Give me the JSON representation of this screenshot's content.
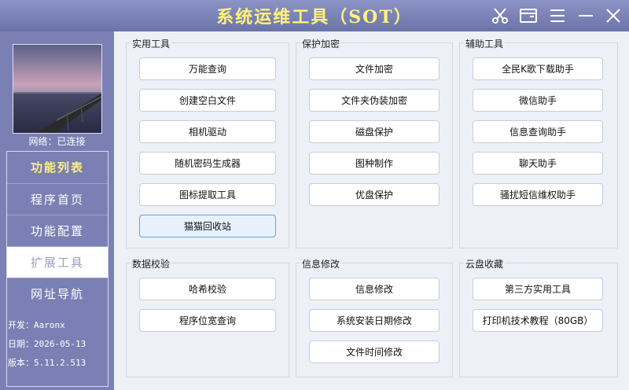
{
  "window": {
    "title": "系统运维工具（SOT）"
  },
  "titlebar_icons": [
    "scissors-icon",
    "window-icon",
    "menu-icon",
    "minimize-icon",
    "close-icon"
  ],
  "sidebar": {
    "network_status": "网络：已连接",
    "nav_header": "功能列表",
    "nav_items": [
      {
        "label": "程序首页",
        "active": false
      },
      {
        "label": "功能配置",
        "active": false
      },
      {
        "label": "扩展工具",
        "active": true
      },
      {
        "label": "网址导航",
        "active": false
      }
    ],
    "info": [
      {
        "label": "开发：",
        "value": "Aaronx"
      },
      {
        "label": "日期：",
        "value": "2026-05-13"
      },
      {
        "label": "版本：",
        "value": "5.11.2.513"
      }
    ]
  },
  "groups": [
    {
      "title": "实用工具",
      "buttons": [
        "万能查询",
        "创建空白文件",
        "相机驱动",
        "随机密码生成器",
        "图标提取工具",
        "猫猫回收站"
      ],
      "hover_index": 5
    },
    {
      "title": "保护加密",
      "buttons": [
        "文件加密",
        "文件夹伪装加密",
        "磁盘保护",
        "图种制作",
        "优盘保护"
      ]
    },
    {
      "title": "辅助工具",
      "buttons": [
        "全民K歌下载助手",
        "微信助手",
        "信息查询助手",
        "聊天助手",
        "骚扰短信维权助手"
      ]
    },
    {
      "title": "数据校验",
      "buttons": [
        "哈希校验",
        "程序位宽查询"
      ]
    },
    {
      "title": "信息修改",
      "buttons": [
        "信息修改",
        "系统安装日期修改",
        "文件时间修改"
      ]
    },
    {
      "title": "云盘收藏",
      "buttons": [
        "第三方实用工具",
        "打印机技术教程（80GB）"
      ]
    }
  ]
}
